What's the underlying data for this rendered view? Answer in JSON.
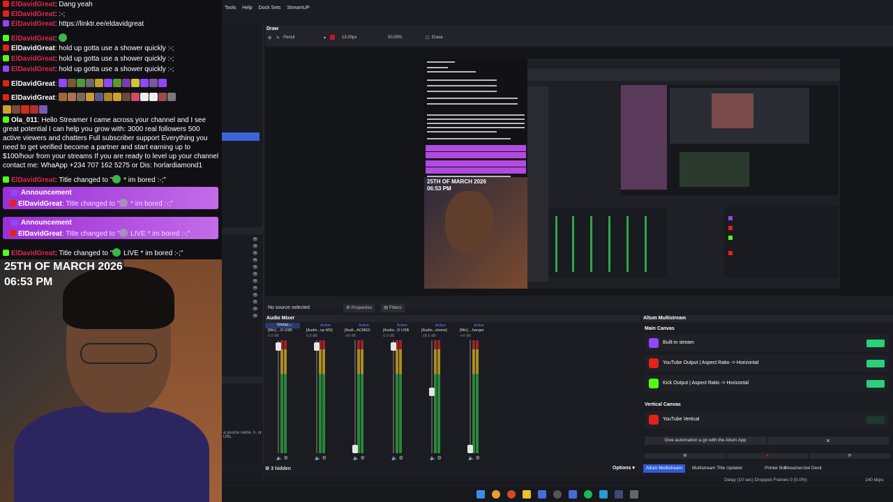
{
  "chat": {
    "messages": [
      {
        "user": "ElDavidGreat",
        "text": ": Dang yeah"
      },
      {
        "user": "ElDavidGreat",
        "text": ": :-;"
      },
      {
        "user": "ElDavidGreat",
        "text": ": https://linktr.ee/eldavidgreat"
      },
      {
        "user": "ElDavidGreat",
        "text": ":"
      },
      {
        "user": "ElDavidGreat",
        "text": ": hold up gotta use a shower quickly :-;"
      },
      {
        "user": "ElDavidGreat",
        "text": ": hold up gotta use a shower quickly :-;"
      },
      {
        "user": "ElDavidGreat",
        "text": ": hold up gotta use a shower quickly :-;"
      },
      {
        "user": "ElDavidGreat",
        "text": ":"
      },
      {
        "user": "ElDavidGreat",
        "text": ":"
      }
    ],
    "spam": {
      "user": "Ola_011",
      "text": ": Hello Streamer I came across your channel and I see great potential I can help you grow with: 3000 real followers 500 active viewers and chatters Full subscriber support Everything you need to get verified become a partner and start earning up to $100/hour from your streams If you are ready to level up your channel contact me: WhaApp +234 707 162 5275 or Dis: horlardiamond1"
    },
    "title_msg_1": {
      "user": "ElDavidGreat",
      "text": ": Title changed to \"",
      "tail": " * im bored :-;\""
    },
    "announcements": [
      {
        "title": "Announcement",
        "user": "ElDavidGreat",
        "text": ": Title changed to \"",
        "tail": " * im bored :-;\""
      },
      {
        "title": "Announcement",
        "user": "ElDavidGreat",
        "text": ": Title changed to \"",
        "tail": " LIVE * im bored :-;\""
      }
    ],
    "title_msg_2": {
      "user": "ElDavidGreat",
      "text": ": Title changed to \"",
      "tail": " LIVE * im bored :-;\""
    }
  },
  "webcam": {
    "date": "25TH OF MARCH 2026",
    "time": "06:53 PM"
  },
  "obs": {
    "menu": [
      "Tools",
      "Help",
      "Dock Sets",
      "StreamUP"
    ],
    "draw": {
      "title": "Draw",
      "tool": "Pencil",
      "size": "13.00px",
      "opacity": "50.00%",
      "erase": "Erase"
    },
    "source_status": "No source selected",
    "properties_label": "Properties",
    "filters_label": "Filters",
    "side_hint": "a source name, h, or URL.",
    "mixer": {
      "title": "Audio Mixer",
      "global_tab": "Global",
      "channels": [
        {
          "active": "Active",
          "name": "[Mic] ...2i USB",
          "db": "0.0 dB",
          "fader": 0.02
        },
        {
          "active": "Active",
          "name": "[Audio...op MS]",
          "db": "0.0 dB",
          "fader": 0.02
        },
        {
          "active": "Active",
          "name": "[Audi...ACMES",
          "db": "-inf dB",
          "fader": 1.0
        },
        {
          "active": "Active",
          "name": "[Audio...2i USB",
          "db": "0.0 dB",
          "fader": 0.02
        },
        {
          "active": "Active",
          "name": "[Audio...olume]",
          "db": "-18.5 dB",
          "fader": 0.45
        },
        {
          "active": "Active",
          "name": "[Mic] ...hanger",
          "db": "-inf dB",
          "fader": 1.0
        }
      ]
    },
    "altum": {
      "title": "Altum Multistream",
      "main_canvas": "Main Canvas",
      "vertical_canvas": "Vertical Canvas",
      "outputs": [
        {
          "label": "Built-in stream",
          "color": "#9146ff",
          "on": true
        },
        {
          "label": "YouTube Output | Aspect Ratio -> Horizontal",
          "color": "#e62117",
          "on": true
        },
        {
          "label": "Kick Output | Aspect Ratio -> Horizontal",
          "color": "#53fc18",
          "on": true
        }
      ],
      "vertical_outputs": [
        {
          "label": "YouTube Vertical",
          "color": "#e62117",
          "on": false
        }
      ],
      "automation_btn": "Give automation a go with the Altum App",
      "close_glyph": "×"
    },
    "hidden_count": "3 hidden",
    "options_label": "Options",
    "dock_tabs": [
      "Altum Multistream",
      "Multistream Title Updater",
      "Printer Bot",
      "Streamer.bot Deck"
    ],
    "status": "Delay (10 sec)  Dropped Frames 0 (0.0%)",
    "kbps": "140 kbps"
  },
  "preview": {
    "date": "25TH OF MARCH 2026",
    "time": "06:53 PM"
  },
  "colors": {
    "accent": "#2f5bd6",
    "announcement": "#b24ae0",
    "toggle_on": "#2ad07a",
    "username_red": "#e0284a"
  }
}
